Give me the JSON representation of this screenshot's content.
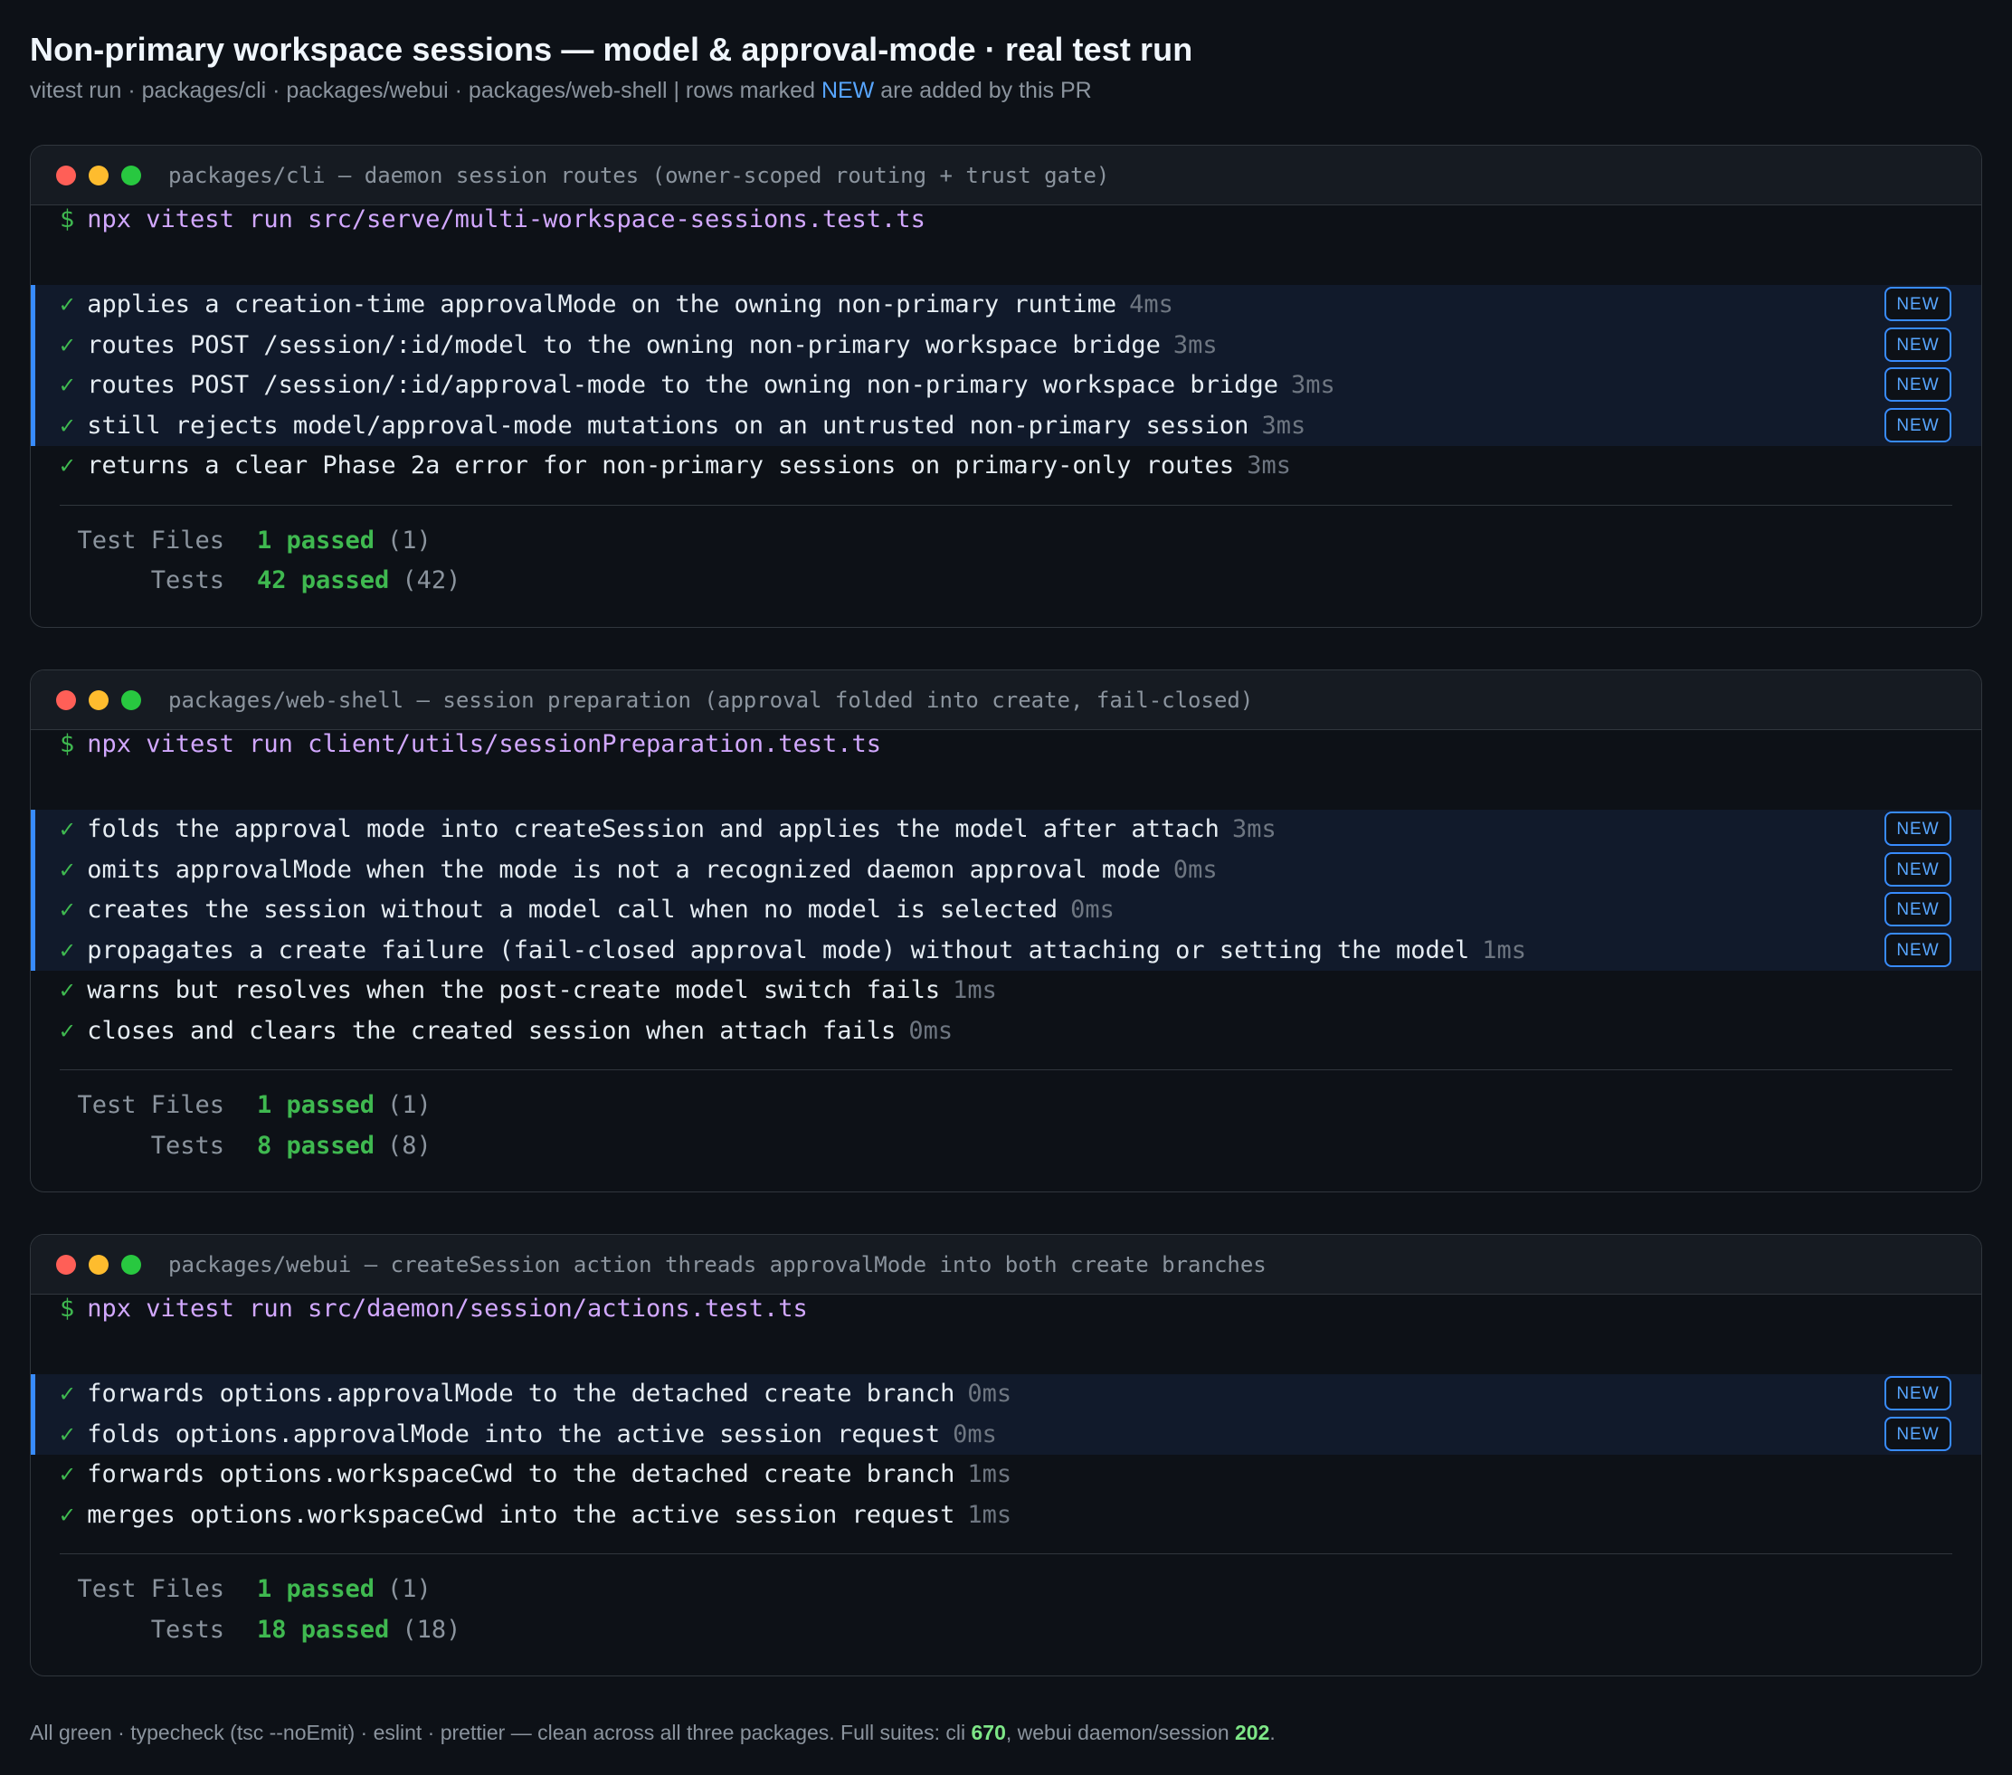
{
  "title": "Non-primary workspace sessions — model & approval-mode · real test run",
  "subtitle": {
    "before": "vitest run · packages/cli · packages/webui · packages/web-shell  |  rows marked ",
    "new_word": "NEW",
    "after": " are added by this PR"
  },
  "badge_label": "NEW",
  "colors": {
    "background": "#0d1117",
    "pass_green": "#3fb950",
    "new_blue": "#388bfd",
    "command_purple": "#d2a8ff"
  },
  "panels": [
    {
      "title": "packages/cli — daemon session routes (owner-scoped routing + trust gate)",
      "prompt": "$",
      "command": "npx vitest run src/serve/multi-workspace-sessions.test.ts",
      "new_tests": [
        {
          "name": "applies a creation-time approvalMode on the owning non-primary runtime",
          "duration": "4ms"
        },
        {
          "name": "routes POST /session/:id/model to the owning non-primary workspace bridge",
          "duration": "3ms"
        },
        {
          "name": "routes POST /session/:id/approval-mode to the owning non-primary workspace bridge",
          "duration": "3ms"
        },
        {
          "name": "still rejects model/approval-mode mutations on an untrusted non-primary session",
          "duration": "3ms"
        }
      ],
      "other_tests": [
        {
          "name": "returns a clear Phase 2a error for non-primary sessions on primary-only routes",
          "duration": "3ms"
        }
      ],
      "summary": {
        "files_label": "Test Files",
        "files_passed": "1 passed",
        "files_total": "(1)",
        "tests_label": "Tests",
        "tests_passed": "42 passed",
        "tests_total": "(42)"
      }
    },
    {
      "title": "packages/web-shell — session preparation (approval folded into create, fail-closed)",
      "prompt": "$",
      "command": "npx vitest run client/utils/sessionPreparation.test.ts",
      "new_tests": [
        {
          "name": "folds the approval mode into createSession and applies the model after attach",
          "duration": "3ms"
        },
        {
          "name": "omits approvalMode when the mode is not a recognized daemon approval mode",
          "duration": "0ms"
        },
        {
          "name": "creates the session without a model call when no model is selected",
          "duration": "0ms"
        },
        {
          "name": "propagates a create failure (fail-closed approval mode) without attaching or setting the model",
          "duration": "1ms"
        }
      ],
      "other_tests": [
        {
          "name": "warns but resolves when the post-create model switch fails",
          "duration": "1ms"
        },
        {
          "name": "closes and clears the created session when attach fails",
          "duration": "0ms"
        }
      ],
      "summary": {
        "files_label": "Test Files",
        "files_passed": "1 passed",
        "files_total": "(1)",
        "tests_label": "Tests",
        "tests_passed": "8 passed",
        "tests_total": "(8)"
      }
    },
    {
      "title": "packages/webui — createSession action threads approvalMode into both create branches",
      "prompt": "$",
      "command": "npx vitest run src/daemon/session/actions.test.ts",
      "new_tests": [
        {
          "name": "forwards options.approvalMode to the detached create branch",
          "duration": "0ms"
        },
        {
          "name": "folds options.approvalMode into the active session request",
          "duration": "0ms"
        }
      ],
      "other_tests": [
        {
          "name": "forwards options.workspaceCwd to the detached create branch",
          "duration": "1ms"
        },
        {
          "name": "merges options.workspaceCwd into the active session request",
          "duration": "1ms"
        }
      ],
      "summary": {
        "files_label": "Test Files",
        "files_passed": "1 passed",
        "files_total": "(1)",
        "tests_label": "Tests",
        "tests_passed": "18 passed",
        "tests_total": "(18)"
      }
    }
  ],
  "footer": {
    "before": "All green · typecheck (tsc --noEmit) · eslint · prettier — clean across all three packages. Full suites: cli ",
    "cli_count": "670",
    "middle": ", webui daemon/session ",
    "webui_count": "202",
    "after": "."
  }
}
